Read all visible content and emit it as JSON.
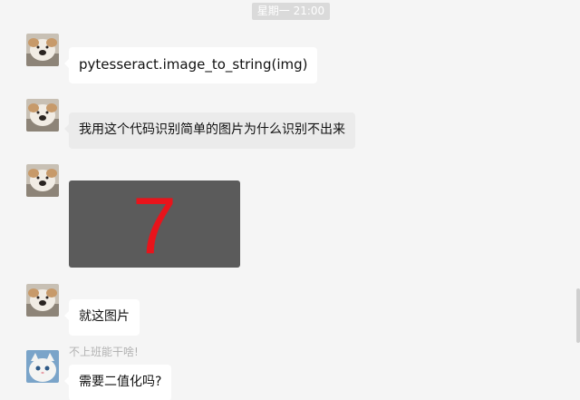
{
  "timestamp": "星期一 21:00",
  "messages": [
    {
      "type": "text",
      "sender": "",
      "text": "pytesseract.image_to_string(img)",
      "avatar_icon": "dog-avatar-icon"
    },
    {
      "type": "text",
      "sender": "",
      "text": "我用这个代码识别简单的图片为什么识别不出来",
      "avatar_icon": "dog-avatar-icon"
    },
    {
      "type": "image",
      "sender": "",
      "image_text": "7",
      "image_bg": "#5b5b5b",
      "digit_color": "#e8141b",
      "avatar_icon": "dog-avatar-icon"
    },
    {
      "type": "text",
      "sender": "",
      "text": "就这图片",
      "avatar_icon": "dog-avatar-icon"
    },
    {
      "type": "text",
      "sender": "不上班能干啥!",
      "text": "需要二值化吗?",
      "avatar_icon": "cat-avatar-icon"
    }
  ],
  "colors": {
    "background": "#f5f5f5",
    "bubble": "#ffffff",
    "timestamp_bg": "#dadada"
  }
}
